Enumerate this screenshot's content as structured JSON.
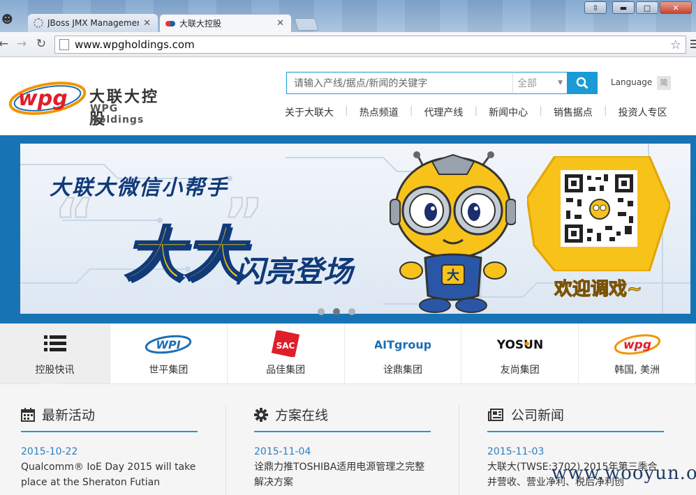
{
  "browser": {
    "tabs": [
      {
        "title": "JBoss JMX Management",
        "active": false
      },
      {
        "title": "大联大控股",
        "active": true
      }
    ],
    "url": "www.wpgholdings.com"
  },
  "header": {
    "brand_logo_text": "wpg",
    "brand_cn": "大联大控股",
    "brand_en": "WPG Holdings",
    "search_placeholder": "请输入产线/据点/新闻的关键字",
    "search_scope": "全部",
    "language_label": "Language",
    "language_button": "简",
    "nav": [
      "关于大联大",
      "热点频道",
      "代理产线",
      "新闻中心",
      "销售据点",
      "投资人专区"
    ]
  },
  "banner": {
    "line1": "大联大微信小帮手",
    "big": "大大",
    "line2": "闪亮登场",
    "greeting": "欢迎调戏~",
    "mascot_badge": "大",
    "slides": 3,
    "active_slide": 2
  },
  "groups": [
    {
      "label": "控股快讯",
      "icon": "list-icon",
      "logo_text": "",
      "active": true
    },
    {
      "label": "世平集团",
      "icon": "wpi-logo",
      "logo_text": "WPI",
      "active": false
    },
    {
      "label": "品佳集团",
      "icon": "sac-logo",
      "logo_text": "SAC",
      "active": false
    },
    {
      "label": "诠鼎集团",
      "icon": "ait-logo",
      "logo_text": "AITgroup",
      "active": false
    },
    {
      "label": "友尚集团",
      "icon": "yosun-logo",
      "logo_text": "YOSUN",
      "active": false
    },
    {
      "label": "韩国, 美洲",
      "icon": "wpg-logo",
      "logo_text": "wpg",
      "active": false
    }
  ],
  "columns": [
    {
      "title": "最新活动",
      "icon": "calendar-icon",
      "date": "2015-10-22",
      "text": "Qualcomm® IoE Day 2015 will take place at the Sheraton Futian"
    },
    {
      "title": "方案在线",
      "icon": "gear-icon",
      "date": "2015-11-04",
      "text": "诠鼎力推TOSHIBA适用电源管理之完整解决方案"
    },
    {
      "title": "公司新闻",
      "icon": "newspaper-icon",
      "date": "2015-11-03",
      "text": "大联大(TWSE:3702) 2015年第三季合并营收、营业净利、税后净利创"
    }
  ],
  "watermark": "www.wooyun.org",
  "colors": {
    "accent": "#1b9ad6",
    "banner_frame": "#1873b5",
    "title_yellow": "#f6c400",
    "title_navy": "#103a7a"
  }
}
